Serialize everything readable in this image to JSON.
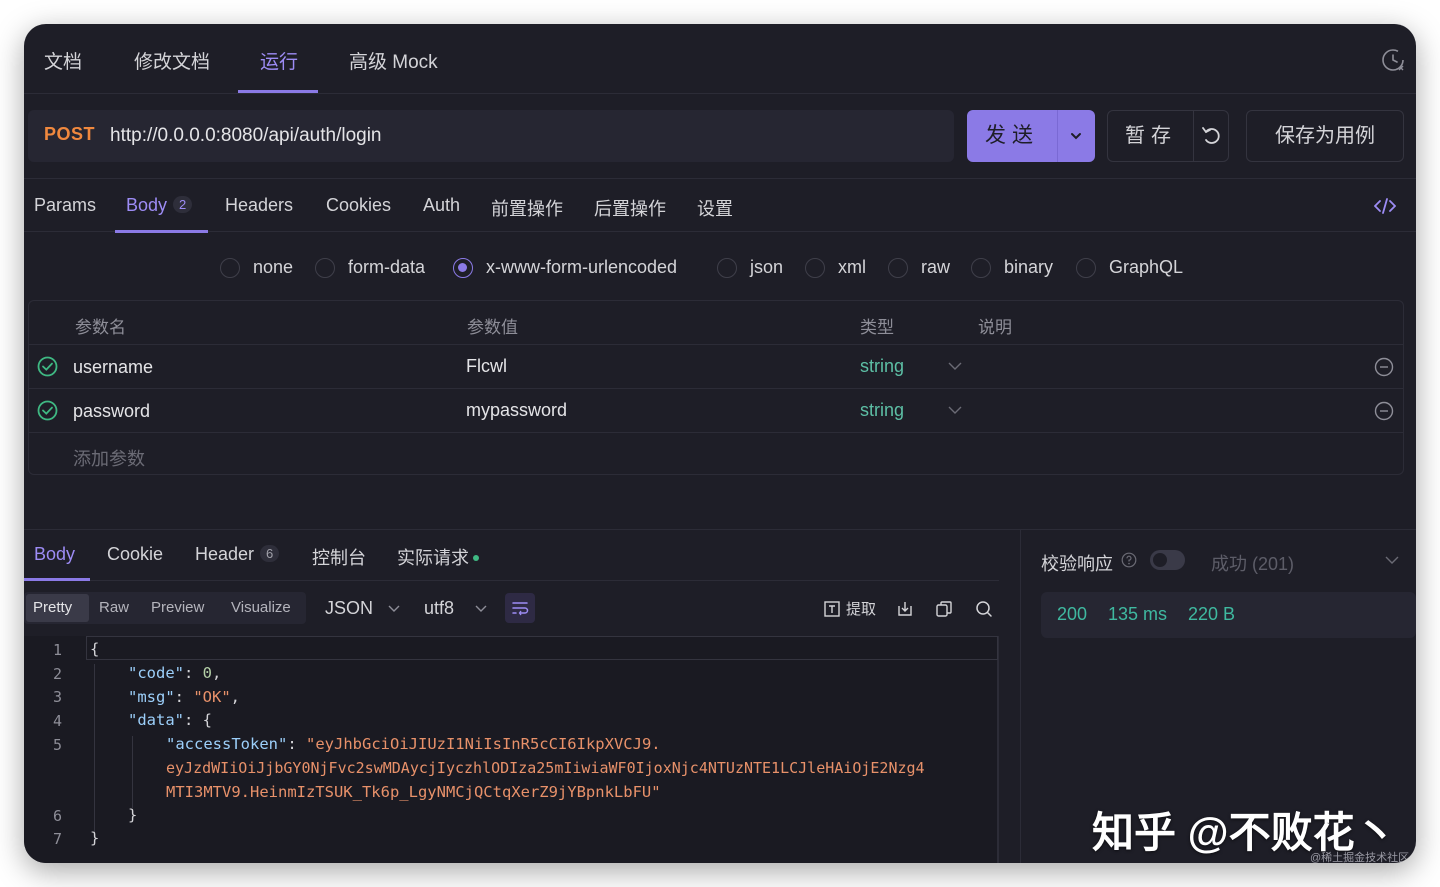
{
  "top_tabs": [
    "文档",
    "修改文档",
    "运行",
    "高级 Mock"
  ],
  "request": {
    "method": "POST",
    "url": "http://0.0.0.0:8080/api/auth/login",
    "send_label": "发送",
    "save_temp_label": "暂存",
    "save_case_label": "保存为用例"
  },
  "req_tabs": {
    "params": "Params",
    "body": "Body",
    "body_count": "2",
    "headers": "Headers",
    "cookies": "Cookies",
    "auth": "Auth",
    "pre": "前置操作",
    "post": "后置操作",
    "settings": "设置"
  },
  "body_types": [
    "none",
    "form-data",
    "x-www-form-urlencoded",
    "json",
    "xml",
    "raw",
    "binary",
    "GraphQL"
  ],
  "body_type_selected": "x-www-form-urlencoded",
  "params_table": {
    "headers": [
      "参数名",
      "参数值",
      "类型",
      "说明"
    ],
    "rows": [
      {
        "name": "username",
        "value": "Flcwl",
        "type": "string",
        "desc": ""
      },
      {
        "name": "password",
        "value": "mypassword",
        "type": "string",
        "desc": ""
      }
    ],
    "add_label": "添加参数"
  },
  "response_tabs": {
    "body": "Body",
    "cookie": "Cookie",
    "header": "Header",
    "header_count": "6",
    "console": "控制台",
    "actual": "实际请求"
  },
  "view_modes": [
    "Pretty",
    "Raw",
    "Preview",
    "Visualize"
  ],
  "format": "JSON",
  "encoding": "utf8",
  "extract_label": "提取",
  "code_lines": {
    "n": [
      "1",
      "2",
      "3",
      "4",
      "5",
      "",
      "",
      "6",
      "7"
    ],
    "l1": "{",
    "code_key": "\"code\"",
    "code_val": "0",
    "msg_key": "\"msg\"",
    "msg_val": "\"OK\"",
    "data_key": "\"data\"",
    "token_key": "\"accessToken\"",
    "token_1": "\"eyJhbGciOiJIUzI1NiIsInR5cCI6IkpXVCJ9.",
    "token_2": "eyJzdWIiOiJjbGY0NjFvc2swMDAycjIyczhlODIza25mIiwiaWF0IjoxNjc4NTUzNTE1LCJleHAiOjE2Nzg4",
    "token_3": "MTI3MTV9.HeinmIzTSUK_Tk6p_LgyNMCjQCtqXerZ9jYBpnkLbFU\"",
    "l6": "}",
    "l7": "}"
  },
  "verify": {
    "label": "校验响应",
    "selected": "成功 (201)"
  },
  "status": {
    "code": "200",
    "time": "135 ms",
    "size": "220 B"
  },
  "watermark": "知乎 @不败花丶",
  "credit": "@稀土掘金技术社区",
  "colors": {
    "accent": "#8b7ae6",
    "method": "#f0883e",
    "success": "#3fb9a0",
    "background": "#1e1e27"
  }
}
